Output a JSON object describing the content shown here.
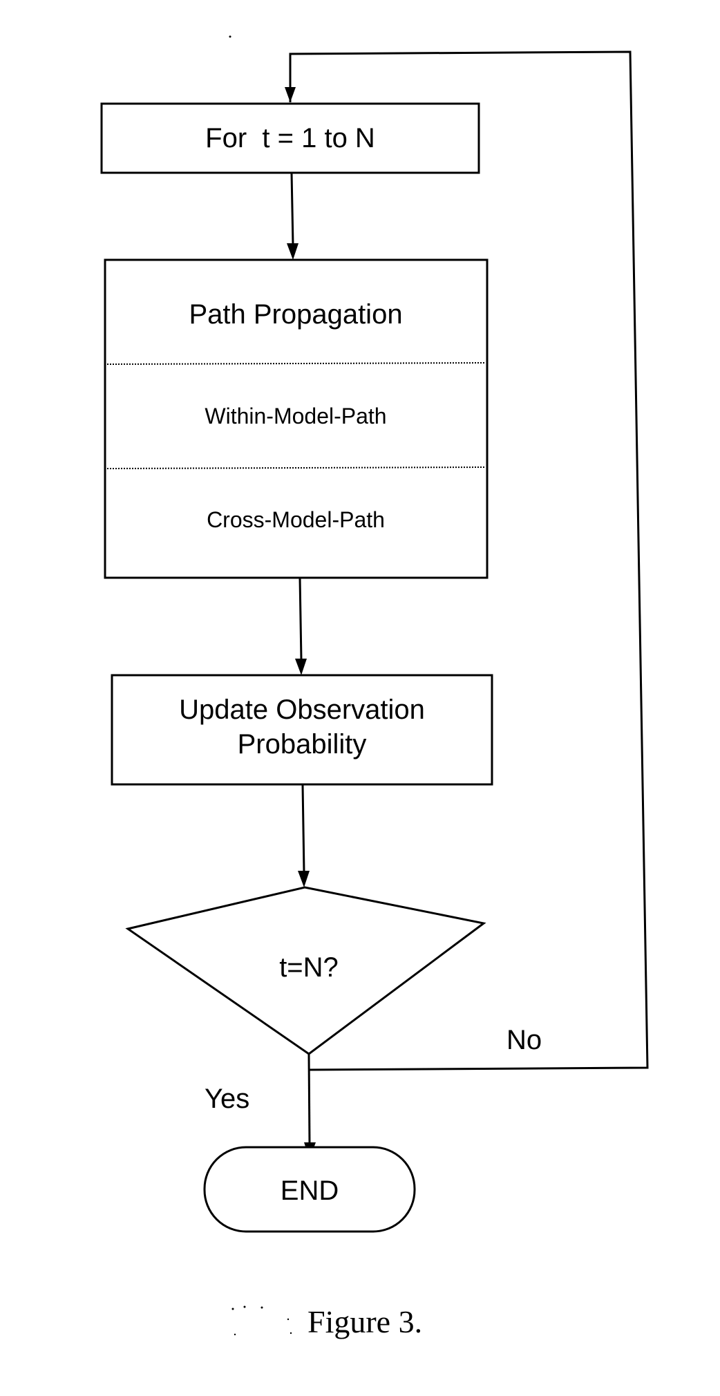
{
  "figure": {
    "caption": "Figure 3.",
    "nodes": {
      "loop": {
        "label": "For  t = 1 to N"
      },
      "path_propagation": {
        "title": "Path Propagation",
        "sections": [
          "Within-Model-Path",
          "Cross-Model-Path"
        ]
      },
      "update": {
        "line1": "Update Observation",
        "line2": "Probability"
      },
      "decision": {
        "label": "t=N?"
      },
      "end": {
        "label": "END"
      }
    },
    "edges": {
      "yes_label": "Yes",
      "no_label": "No"
    }
  }
}
